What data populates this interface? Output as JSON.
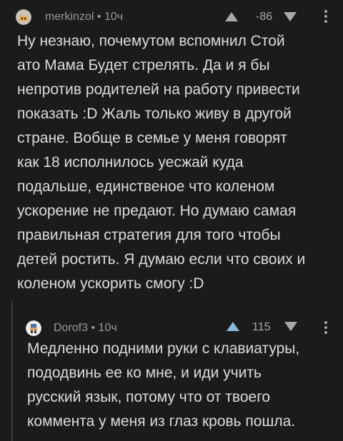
{
  "comments": [
    {
      "username": "merkinzol",
      "time": "10ч",
      "rating": "-86",
      "avatar_icon": "cat-face-avatar",
      "lines": [
        "Ну незнаю, почемутом вспомнил Стой",
        "ато Мама Будет стрелять. Да и я бы",
        "непротив родителей на работу привести",
        "показать :D Жаль только живу в другой",
        "стране. Вобще в семье у меня говорят",
        "как 18 исполнилось уесжай куда",
        "подальше, единственое что коленом",
        "ускорение не предают. Но думаю самая",
        "правильная стратегия для того чтобы",
        "детей ростить. Я думаю если что своих и",
        "коленом ускорить смогу :D"
      ]
    },
    {
      "username": "Dorof3",
      "time": "10ч",
      "rating": "115",
      "avatar_icon": "pixel-character-avatar",
      "lines": [
        "Медленно подними руки с клавиатуры,",
        "пододвинь ее ко мне, и иди учить",
        "русский язык, потому что от твоего",
        "коммента у меня из глаз кровь пошла."
      ]
    }
  ],
  "separator": " • ",
  "colors": {
    "background": "#1b1b1b",
    "text": "#dcdcdc",
    "meta": "#9a9a9a",
    "upvote_active": "#8ab8dd"
  }
}
